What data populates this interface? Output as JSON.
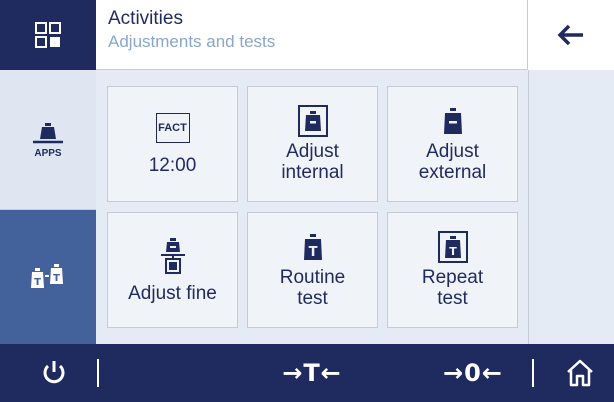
{
  "header": {
    "title": "Activities",
    "subtitle": "Adjustments and tests",
    "home_icon": "grid-icon",
    "back_icon": "arrow-left-icon"
  },
  "sidebar": {
    "apps_label": "APPS",
    "apps_icon": "weight-apps-icon",
    "adjust_icon": "adjust-weights-icon"
  },
  "tiles": [
    {
      "id": "fact",
      "icon_text": "FACT",
      "label": "12:00"
    },
    {
      "id": "adjust-internal",
      "label_line1": "Adjust",
      "label_line2": "internal"
    },
    {
      "id": "adjust-external",
      "label_line1": "Adjust",
      "label_line2": "external"
    },
    {
      "id": "adjust-fine",
      "label": "Adjust fine"
    },
    {
      "id": "routine-test",
      "label_line1": "Routine",
      "label_line2": "test"
    },
    {
      "id": "repeat-test",
      "label_line1": "Repeat",
      "label_line2": "test"
    }
  ],
  "weight_letter": "T",
  "bottom": {
    "tare_label": "→T←",
    "zero_label": "→0←",
    "power_icon": "power-icon",
    "home_icon": "home-icon"
  },
  "colors": {
    "navy": "#1f2b5e",
    "active_blue": "#43619b",
    "panel": "#e5ebf4",
    "subtitle": "#8aa6c8"
  }
}
